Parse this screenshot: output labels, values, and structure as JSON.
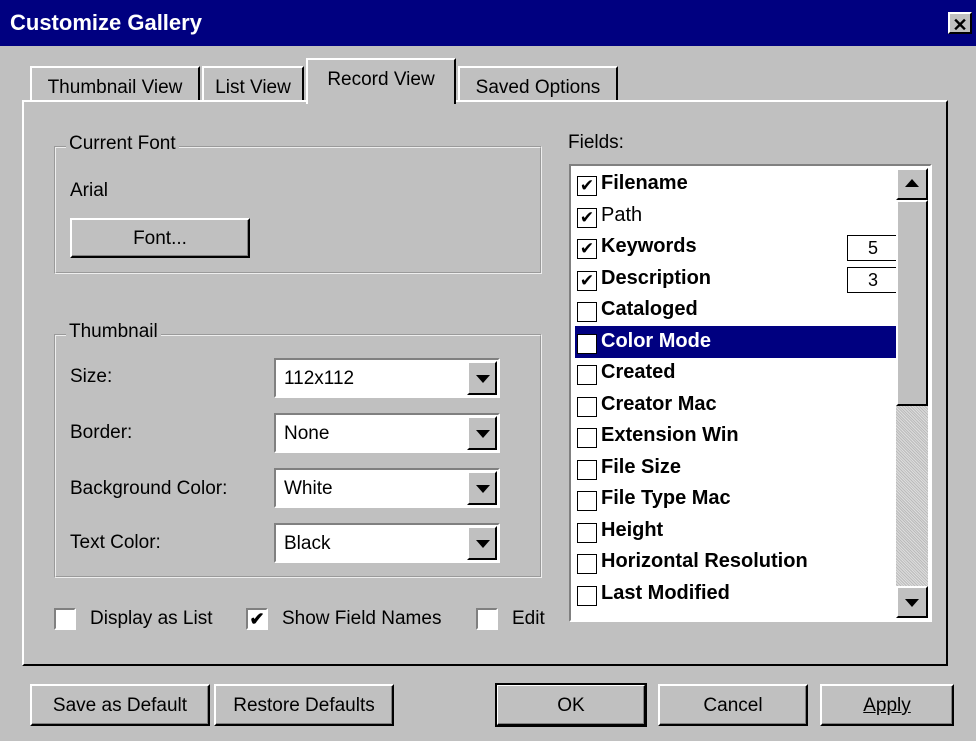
{
  "window": {
    "title": "Customize Gallery",
    "close_glyph": "✕"
  },
  "tabs": [
    {
      "label": "Thumbnail View",
      "active": false
    },
    {
      "label": "List View",
      "active": false
    },
    {
      "label": "Record View",
      "active": true
    },
    {
      "label": "Saved Options",
      "active": false
    }
  ],
  "current_font": {
    "group_label": "Current Font",
    "font_name": "Arial",
    "button_label": "Font..."
  },
  "thumbnail": {
    "group_label": "Thumbnail",
    "size_label": "Size:",
    "size_value": "112x112",
    "border_label": "Border:",
    "border_value": "None",
    "bg_label": "Background Color:",
    "bg_value": "White",
    "text_label": "Text Color:",
    "text_value": "Black"
  },
  "options": {
    "display_list": {
      "label": "Display as List",
      "checked": false
    },
    "show_field_names": {
      "label": "Show Field Names",
      "checked": true
    },
    "edit": {
      "label": "Edit",
      "checked": false
    }
  },
  "fields": {
    "label": "Fields:",
    "items": [
      {
        "label": "Filename",
        "checked": true,
        "bold": true
      },
      {
        "label": "Path",
        "checked": true,
        "bold": false
      },
      {
        "label": "Keywords",
        "checked": true,
        "bold": true,
        "lines": "5"
      },
      {
        "label": "Description",
        "checked": true,
        "bold": true,
        "lines": "3"
      },
      {
        "label": "Cataloged",
        "checked": false,
        "bold": true
      },
      {
        "label": "Color Mode",
        "checked": false,
        "bold": true,
        "selected": true
      },
      {
        "label": "Created",
        "checked": false,
        "bold": true
      },
      {
        "label": "Creator Mac",
        "checked": false,
        "bold": true
      },
      {
        "label": "Extension Win",
        "checked": false,
        "bold": true
      },
      {
        "label": "File Size",
        "checked": false,
        "bold": true
      },
      {
        "label": "File Type Mac",
        "checked": false,
        "bold": true
      },
      {
        "label": "Height",
        "checked": false,
        "bold": true
      },
      {
        "label": "Horizontal Resolution",
        "checked": false,
        "bold": true
      },
      {
        "label": "Last Modified",
        "checked": false,
        "bold": true
      }
    ]
  },
  "buttons": {
    "save_default": "Save as Default",
    "restore_defaults": "Restore Defaults",
    "ok": "OK",
    "cancel": "Cancel",
    "apply": "Apply"
  },
  "colors": {
    "title_bar": "#000080",
    "face": "#c0c0c0",
    "selection": "#000080"
  }
}
